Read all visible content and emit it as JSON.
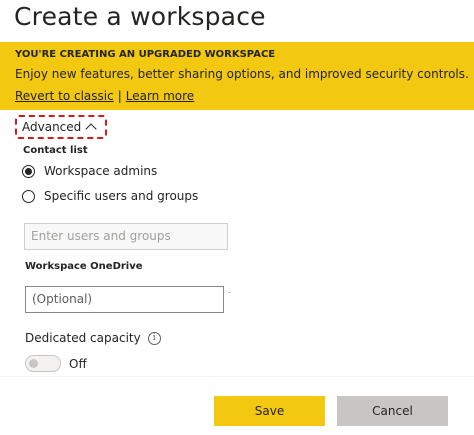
{
  "dialog": {
    "title": "Create a workspace"
  },
  "banner": {
    "heading": "YOU'RE CREATING AN UPGRADED WORKSPACE",
    "text": "Enjoy new features, better sharing options, and improved security controls.",
    "revert_link": "Revert to classic",
    "separator": "|",
    "learn_link": "Learn more"
  },
  "advanced": {
    "label": "Advanced"
  },
  "contact_list": {
    "label": "Contact list",
    "options": [
      {
        "label": "Workspace admins",
        "selected": true
      },
      {
        "label": "Specific users and groups",
        "selected": false
      }
    ],
    "input_placeholder": "Enter users and groups"
  },
  "onedrive": {
    "label": "Workspace OneDrive",
    "placeholder": "(Optional)"
  },
  "capacity": {
    "label": "Dedicated capacity",
    "info_icon": "info-icon",
    "toggle_state": "Off"
  },
  "footer": {
    "save": "Save",
    "cancel": "Cancel"
  },
  "colors": {
    "accent": "#f2c811",
    "highlight_border": "#d01c1c",
    "cancel_bg": "#c8c6c4"
  }
}
